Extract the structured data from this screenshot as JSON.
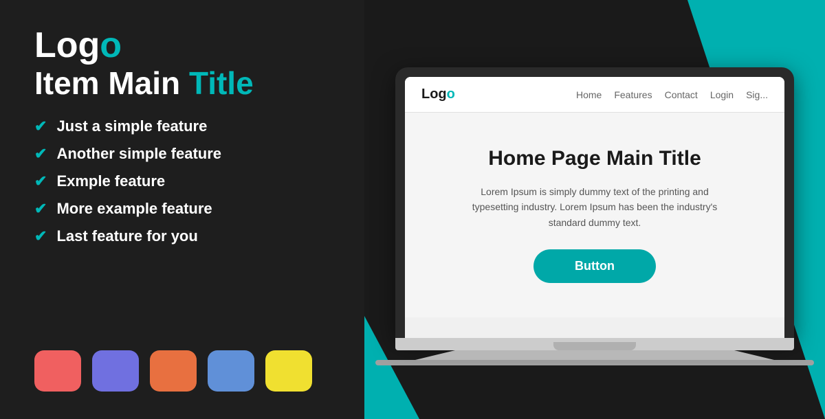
{
  "left": {
    "logo": {
      "text_white": "Log",
      "text_teal": "o"
    },
    "main_title": {
      "text_white": "Item Main ",
      "text_teal": "Title"
    },
    "features": [
      "Just a simple feature",
      "Another simple feature",
      "Exmple feature",
      "More example feature",
      "Last feature for you"
    ],
    "check_symbol": "✔",
    "swatches": [
      {
        "color": "#f06060",
        "name": "red-swatch"
      },
      {
        "color": "#7070e0",
        "name": "purple-swatch"
      },
      {
        "color": "#e87040",
        "name": "orange-swatch"
      },
      {
        "color": "#6090d8",
        "name": "blue-swatch"
      },
      {
        "color": "#f0e030",
        "name": "yellow-swatch"
      }
    ]
  },
  "website": {
    "logo_white": "Log",
    "logo_teal": "o",
    "nav_links": [
      "Home",
      "Features",
      "Contact",
      "Login",
      "Sig..."
    ],
    "hero_title": "Home Page Main Title",
    "hero_text": "Lorem Ipsum is simply dummy text of the printing and typesetting industry. Lorem Ipsum has been the industry's standard dummy text.",
    "button_label": "Button"
  }
}
